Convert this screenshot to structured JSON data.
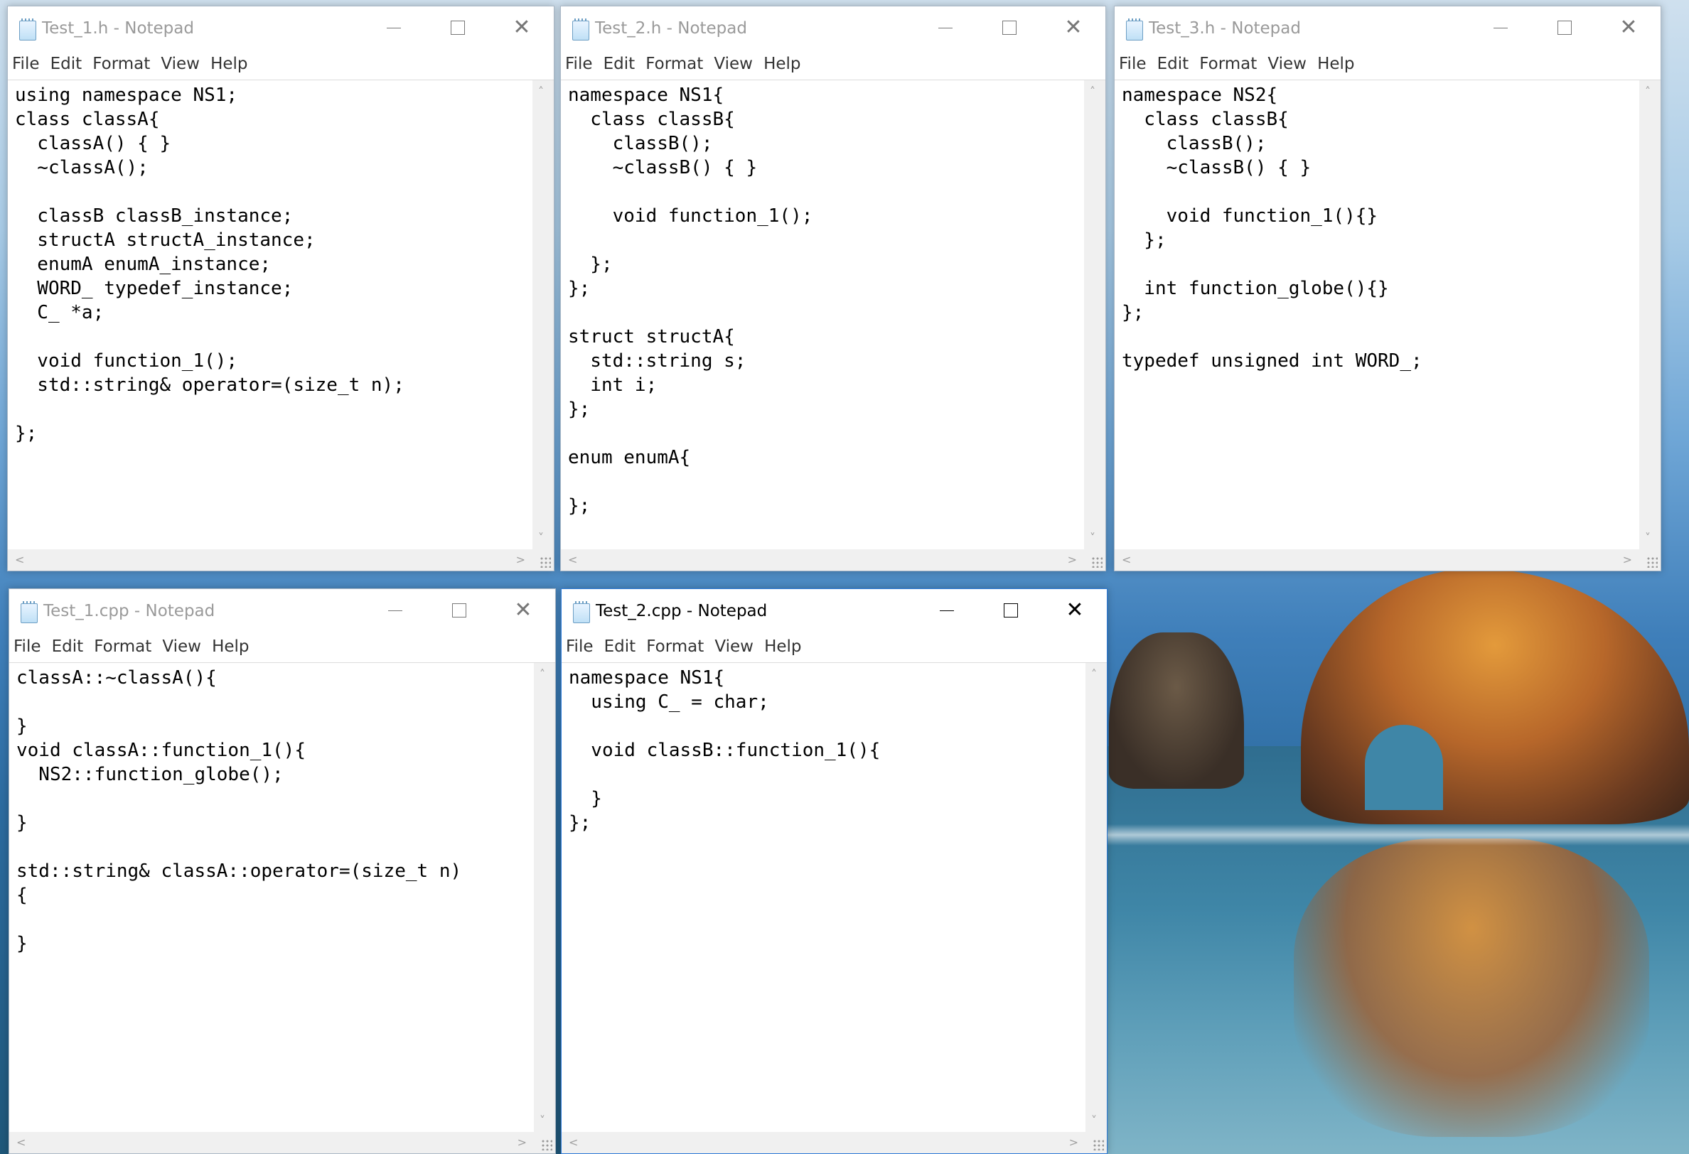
{
  "menu": [
    "File",
    "Edit",
    "Format",
    "View",
    "Help"
  ],
  "windows": [
    {
      "title": "Test_1.h - Notepad",
      "content": "using namespace NS1;\nclass classA{\n  classA() { }\n  ~classA();\n\n  classB classB_instance;\n  structA structA_instance;\n  enumA enumA_instance;\n  WORD_ typedef_instance;\n  C_ *a;\n\n  void function_1();\n  std::string& operator=(size_t n);\n\n};"
    },
    {
      "title": "Test_2.h - Notepad",
      "content": "namespace NS1{\n  class classB{\n    classB();\n    ~classB() { }\n\n    void function_1();\n\n  };\n};\n\nstruct structA{\n  std::string s;\n  int i;\n};\n\nenum enumA{\n\n};"
    },
    {
      "title": "Test_3.h - Notepad",
      "content": "namespace NS2{\n  class classB{\n    classB();\n    ~classB() { }\n\n    void function_1(){}\n  };\n\n  int function_globe(){}\n};\n\ntypedef unsigned int WORD_;"
    },
    {
      "title": "Test_1.cpp - Notepad",
      "content": "classA::~classA(){\n\n}\nvoid classA::function_1(){\n  NS2::function_globe();\n\n}\n\nstd::string& classA::operator=(size_t n)\n{\n\n}"
    },
    {
      "title": "Test_2.cpp - Notepad",
      "content": "namespace NS1{\n  using C_ = char;\n\n  void classB::function_1(){\n\n  }\n};"
    }
  ]
}
